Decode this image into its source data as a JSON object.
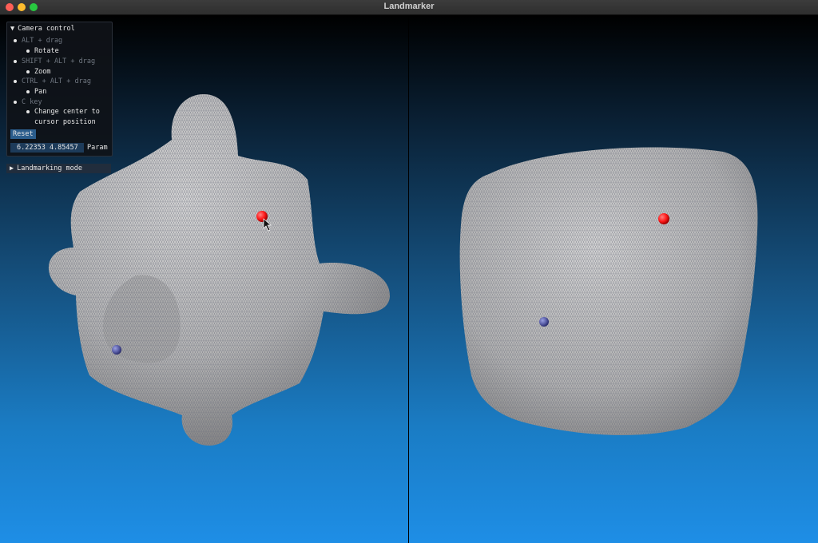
{
  "window": {
    "title": "Landmarker"
  },
  "camera_panel": {
    "header": "Camera control",
    "items": [
      {
        "key": "ALT + drag",
        "action": "Rotate"
      },
      {
        "key": "SHIFT + ALT + drag",
        "action": "Zoom"
      },
      {
        "key": "CTRL + ALT + drag",
        "action": "Pan"
      },
      {
        "key": "C key",
        "action_line1": "Change center to",
        "action_line2": "cursor position"
      }
    ],
    "reset_label": "Reset",
    "param_value": "6.22353 4.85457",
    "param_label": "Param"
  },
  "landmarking_panel": {
    "header": "Landmarking mode"
  },
  "colors": {
    "landmark_red": "#ff1a1a",
    "landmark_blue": "#5a5fa8",
    "mesh_surface": "#bdbdbd",
    "panel_accent": "#2b5d8c"
  },
  "icons": [
    "close-icon",
    "minimize-icon",
    "maximize-icon",
    "triangle-down-icon",
    "triangle-right-icon",
    "cursor-icon"
  ]
}
